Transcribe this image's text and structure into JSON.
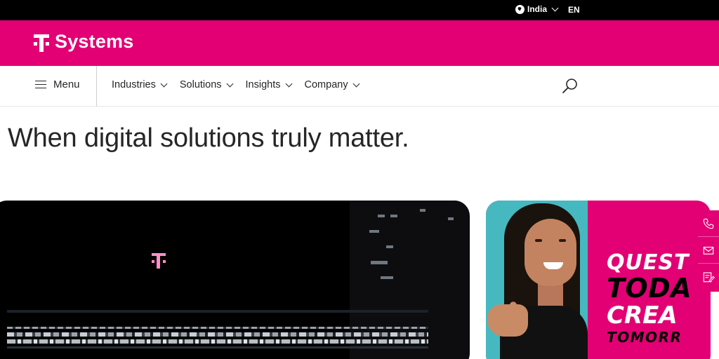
{
  "topbar": {
    "country_label": "India",
    "country_icon": "globe-icon",
    "language_label": "EN"
  },
  "brand": {
    "logo_text": "Systems",
    "logo_icon": "telekom-t-icon",
    "color": "#e20074"
  },
  "nav": {
    "menu_label": "Menu",
    "menu_icon": "hamburger-icon",
    "items": [
      {
        "label": "Industries"
      },
      {
        "label": "Solutions"
      },
      {
        "label": "Insights"
      },
      {
        "label": "Company"
      }
    ],
    "search_icon": "search-icon"
  },
  "hero": {
    "headline": "When digital solutions truly matter."
  },
  "promo": {
    "line1": "QUEST",
    "line2": "TODA",
    "line3": "CREA",
    "line4": "TOMORR"
  },
  "contact_rail": {
    "icons": [
      "phone-icon",
      "mail-icon",
      "contact-form-icon"
    ]
  }
}
